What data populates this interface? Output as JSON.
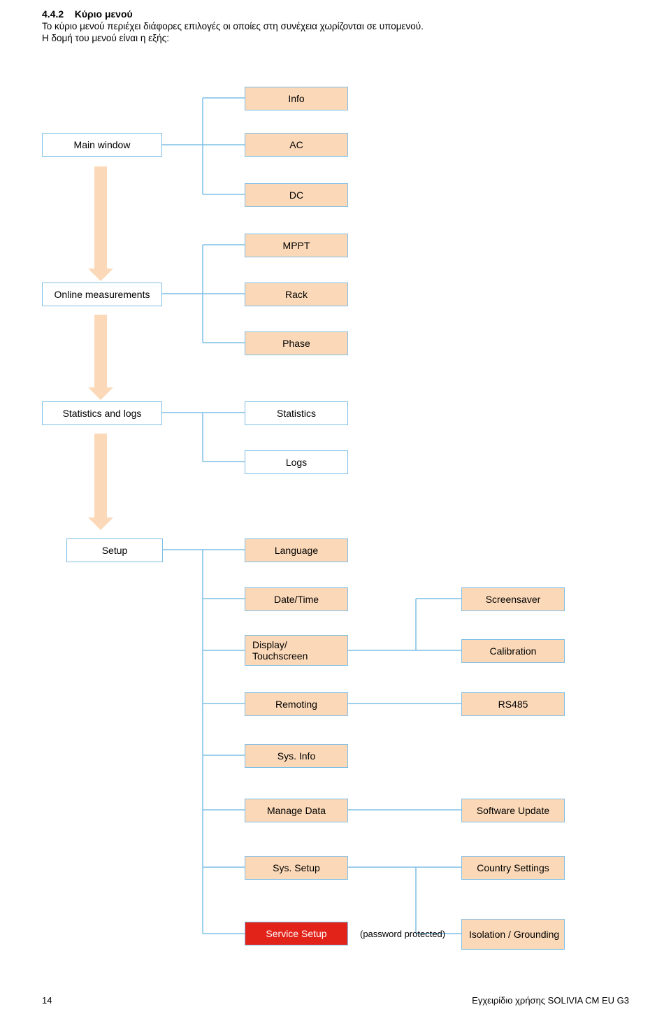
{
  "header": {
    "section_number": "4.4.2",
    "section_title": "Κύριο μενού",
    "line1": "Το κύριο μενού περιέχει διάφορες επιλογές οι οποίες στη συνέχεια χωρίζονται σε υπομενού.",
    "line2": "Η δομή του μενού είναι η εξής:"
  },
  "nodes": {
    "main_window": "Main window",
    "info": "Info",
    "ac": "AC",
    "dc": "DC",
    "online_measurements": "Online measurements",
    "mppt": "MPPT",
    "rack": "Rack",
    "phase": "Phase",
    "statistics_and_logs": "Statistics and logs",
    "statistics": "Statistics",
    "logs": "Logs",
    "setup": "Setup",
    "language": "Language",
    "date_time": "Date/Time",
    "display_touchscreen": "Display/ Touchscreen",
    "remoting": "Remoting",
    "sys_info": "Sys. Info",
    "manage_data": "Manage Data",
    "sys_setup": "Sys. Setup",
    "service_setup": "Service Setup",
    "screensaver": "Screensaver",
    "calibration": "Calibration",
    "rs485": "RS485",
    "software_update": "Software Update",
    "country_settings": "Country Settings",
    "isolation_grounding": "Isolation / Grounding"
  },
  "password_protected": "(password protected)",
  "footer": {
    "page": "14",
    "doc": "Εγχειρίδιο χρήσης SOLIVIA CM EU G3"
  }
}
